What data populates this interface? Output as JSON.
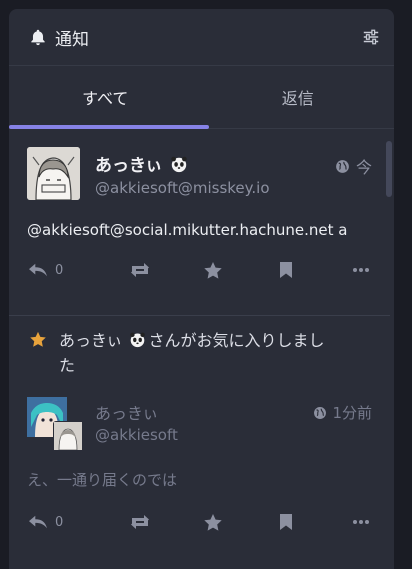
{
  "header": {
    "title": "通知"
  },
  "tabs": [
    {
      "label": "すべて",
      "active": true
    },
    {
      "label": "返信",
      "active": false
    }
  ],
  "note": {
    "name": "あっきぃ",
    "handle": "@akkiesoft@misskey.io",
    "time": "今",
    "text": "@akkiesoft@social.mikutter.hachune.net a",
    "reply_count": "0"
  },
  "favorite_notification": {
    "message": "あっきぃ 🐼さんがお気に入りしました",
    "message_part1": "あっきぃ",
    "message_part2": "さんがお気に入りしまし",
    "message_part3": "た",
    "note": {
      "name": "あっきぃ",
      "handle": "@akkiesoft",
      "time": "1分前",
      "text": "え、一通り届くのでは",
      "reply_count": "0"
    }
  },
  "colors": {
    "background": "#1a1c24",
    "panel": "#2a2d38",
    "accent": "#8682e6",
    "star": "#e8a33c",
    "muted": "#8c90a0"
  },
  "icons": {
    "header": "bell-icon",
    "settings": "sliders-icon",
    "visibility": "globe-icon",
    "reply": "reply-icon",
    "renote": "repeat-icon",
    "favorite": "star-icon",
    "clip": "bookmark-icon",
    "more": "ellipsis-icon"
  }
}
